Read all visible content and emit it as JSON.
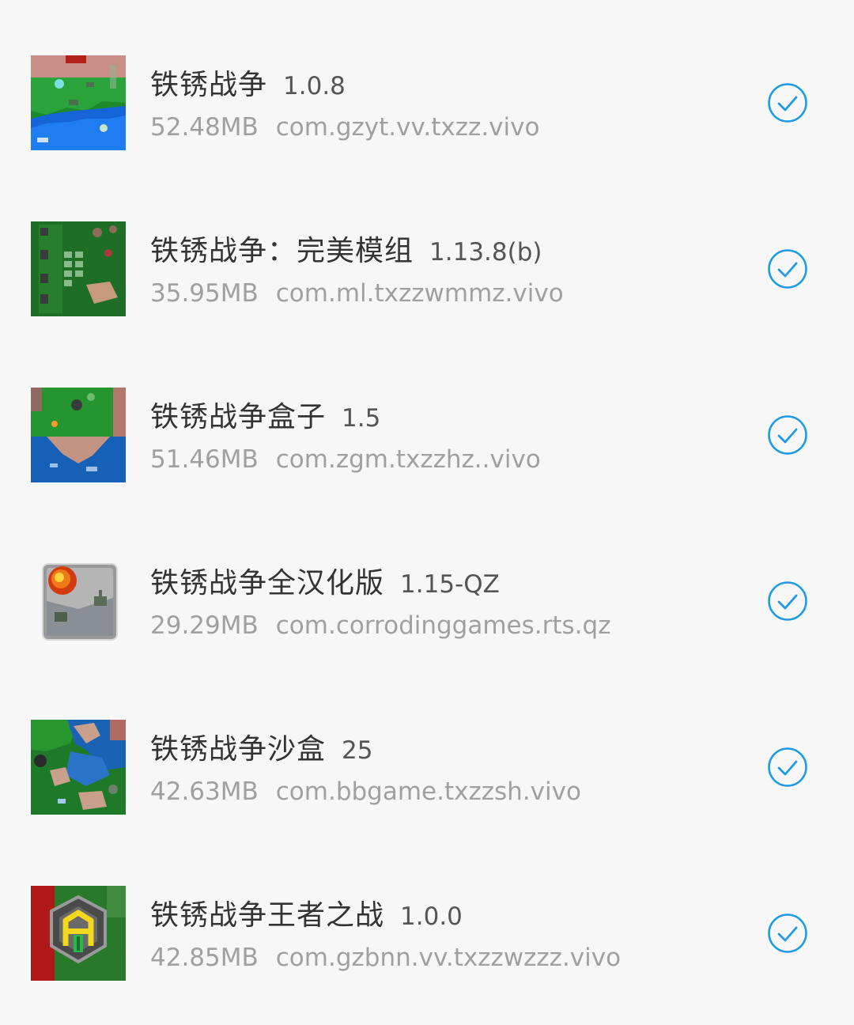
{
  "theme": {
    "background": "#f7f7f7",
    "title_color": "#333333",
    "meta_color": "#a0a0a0",
    "check_color": "#1e9be6"
  },
  "apps": [
    {
      "name": "铁锈战争",
      "version": "1.0.8",
      "size": "52.48MB",
      "package": "com.gzyt.vv.txzz.vivo",
      "icon": "rusted-warfare-green-map-icon",
      "selected": true
    },
    {
      "name": "铁锈战争：完美模组",
      "version": "1.13.8(b)",
      "size": "35.95MB",
      "package": "com.ml.txzzwmmz.vivo",
      "icon": "rusted-warfare-build-menu-icon",
      "selected": true
    },
    {
      "name": "铁锈战争盒子",
      "version": "1.5",
      "size": "51.46MB",
      "package": "com.zgm.txzzhz..vivo",
      "icon": "rusted-warfare-coast-map-icon",
      "selected": true
    },
    {
      "name": "铁锈战争全汉化版",
      "version": "1.15-QZ",
      "size": "29.29MB",
      "package": "com.corrodinggames.rts.qz",
      "icon": "rusted-warfare-explosion-tank-icon",
      "selected": true
    },
    {
      "name": "铁锈战争沙盒",
      "version": "25",
      "size": "42.63MB",
      "package": "com.bbgame.txzzsh.vivo",
      "icon": "rusted-warfare-island-map-icon",
      "selected": true
    },
    {
      "name": "铁锈战争王者之战",
      "version": "1.0.0",
      "size": "42.85MB",
      "package": "com.gzbnn.vv.txzzwzzz.vivo",
      "icon": "rusted-warfare-hexagon-logo-icon",
      "selected": true
    }
  ]
}
